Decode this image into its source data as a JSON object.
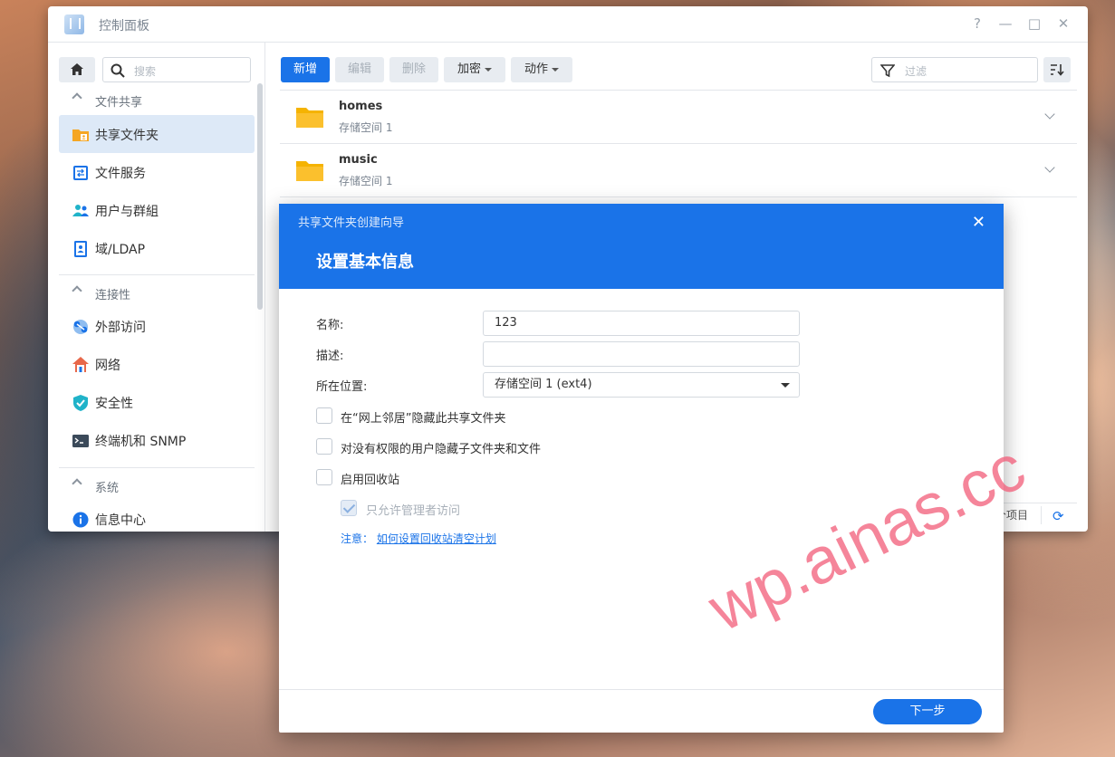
{
  "window": {
    "title": "控制面板",
    "controls": {
      "help": "?",
      "minimize": "—",
      "maximize": "□",
      "close": "✕"
    }
  },
  "sidebar": {
    "search_placeholder": "搜索",
    "sections": [
      {
        "label": "文件共享",
        "items": [
          {
            "label": "共享文件夹",
            "icon": "shared-folder-icon",
            "active": true
          },
          {
            "label": "文件服务",
            "icon": "file-services-icon"
          },
          {
            "label": "用户与群組",
            "icon": "users-icon"
          },
          {
            "label": "域/LDAP",
            "icon": "domain-ldap-icon"
          }
        ]
      },
      {
        "label": "连接性",
        "items": [
          {
            "label": "外部访问",
            "icon": "external-access-icon"
          },
          {
            "label": "网络",
            "icon": "network-icon"
          },
          {
            "label": "安全性",
            "icon": "security-icon"
          },
          {
            "label": "终端机和 SNMP",
            "icon": "terminal-icon"
          }
        ]
      },
      {
        "label": "系统",
        "items": [
          {
            "label": "信息中心",
            "icon": "info-icon"
          }
        ]
      }
    ]
  },
  "toolbar": {
    "create": "新增",
    "edit": "编辑",
    "delete": "删除",
    "encrypt": "加密",
    "action": "动作",
    "filter_placeholder": "过滤"
  },
  "folders": [
    {
      "name": "homes",
      "location": "存储空间 1"
    },
    {
      "name": "music",
      "location": "存储空间 1"
    }
  ],
  "status": {
    "count_text": "个项目"
  },
  "wizard": {
    "subtitle": "共享文件夹创建向导",
    "title": "设置基本信息",
    "fields": {
      "name_label": "名称:",
      "name_value": "123",
      "desc_label": "描述:",
      "desc_value": "",
      "location_label": "所在位置:",
      "location_value": "存储空间 1 (ext4)"
    },
    "options": [
      {
        "label": "在“网上邻居”隐藏此共享文件夹",
        "checked": false
      },
      {
        "label": "对没有权限的用户隐藏子文件夹和文件",
        "checked": false
      },
      {
        "label": "启用回收站",
        "checked": false
      },
      {
        "label": "只允许管理者访问",
        "checked": true,
        "disabled": true
      }
    ],
    "note_label": "注意：",
    "note_link": "如何设置回收站清空计划",
    "next": "下一步"
  },
  "watermark": "wp.ainas.cc",
  "colors": {
    "accent": "#1a73e8",
    "folder": "#f5b301",
    "watermark": "#f25c78"
  }
}
